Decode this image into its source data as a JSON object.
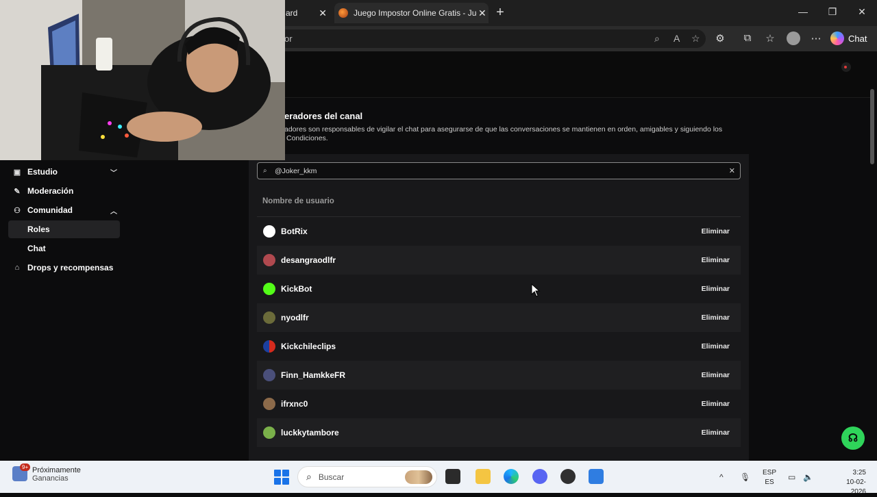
{
  "browser": {
    "tabs": [
      {
        "label": "ard"
      },
      {
        "label": "Juego Impostor Online Gratis - Jue"
      }
    ],
    "url_fragment": "or",
    "chat_label": "Chat"
  },
  "section": {
    "title": "eradores del canal",
    "description": "adores son responsables de vigilar el chat para asegurarse de que las conversaciones se mantienen en orden, amigables y siguiendo los",
    "description2": "Condiciones."
  },
  "sidebar": {
    "items": [
      {
        "label": "Estudio",
        "icon": "studio-icon"
      },
      {
        "label": "Moderación",
        "icon": "wrench-icon"
      },
      {
        "label": "Comunidad",
        "icon": "community-icon"
      },
      {
        "label": "Roles"
      },
      {
        "label": "Chat"
      },
      {
        "label": "Drops y recompensas",
        "icon": "gift-icon"
      }
    ]
  },
  "search": {
    "value": "@Joker_kkm"
  },
  "table": {
    "column_header": "Nombre de usuario",
    "action_label": "Eliminar",
    "rows": [
      {
        "username": "BotRix",
        "avatar_color": "#ffffff"
      },
      {
        "username": "desangraodlfr",
        "avatar_color": "#b0494f"
      },
      {
        "username": "KickBot",
        "avatar_color": "#53fc18"
      },
      {
        "username": "nyodlfr",
        "avatar_color": "#6b6b3a"
      },
      {
        "username": "Kickchileclips",
        "avatar_color": "#d52b1e"
      },
      {
        "username": "Finn_HamkkeFR",
        "avatar_color": "#4a4f7a"
      },
      {
        "username": "ifrxnc0",
        "avatar_color": "#8c6a4a"
      },
      {
        "username": "luckkytambore",
        "avatar_color": "#7ab04a"
      }
    ]
  },
  "taskbar": {
    "weather_title": "Próximamente",
    "weather_sub": "Ganancias",
    "notif_badge": "9+",
    "search_placeholder": "Buscar",
    "lang_top": "ESP",
    "lang_bottom": "ES",
    "time": "3:25",
    "date": "10-02-2026"
  },
  "colors": {
    "accent": "#53fc18",
    "panel": "#18181a"
  }
}
